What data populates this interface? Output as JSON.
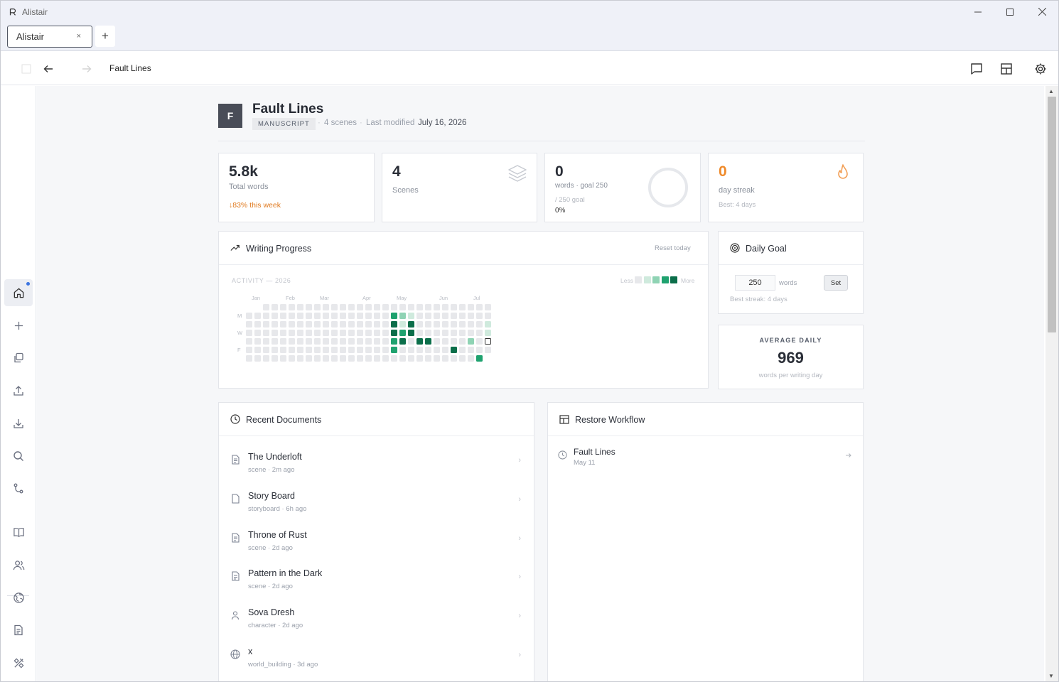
{
  "window": {
    "app_title": "Alistair"
  },
  "tabs": [
    {
      "label": "Alistair",
      "close": "×"
    }
  ],
  "new_tab": "+",
  "breadcrumb": "Fault Lines",
  "project": {
    "initial": "F",
    "title": "Fault Lines",
    "badge": "MANUSCRIPT",
    "scene_count": "4 scenes",
    "last_modified_label": "Last modified",
    "last_modified_date": "July 16, 2026"
  },
  "stats": {
    "words": {
      "value": "5.8k",
      "label": "Total words",
      "trend": "↓83% this week"
    },
    "scenes": {
      "value": "4",
      "label": "Scenes"
    },
    "today": {
      "value": "0",
      "label": "words · goal 250",
      "goal_note": "/ 250 goal",
      "percent": "0%",
      "progress": 0
    },
    "streak": {
      "value": "0",
      "label": "day streak",
      "best": "Best: 4 days"
    }
  },
  "writing_progress": {
    "title": "Writing Progress",
    "reset": "Reset today",
    "activity_label": "ACTIVITY — 2026",
    "legend_less": "Less",
    "legend_more": "More",
    "months": [
      "Jan",
      "Feb",
      "Mar",
      "Apr",
      "May",
      "Jun",
      "Jul"
    ],
    "days": [
      "M",
      "W",
      "F"
    ],
    "num_weeks": 29,
    "active_cells": [
      {
        "w": 17,
        "d": 1,
        "l": 3
      },
      {
        "w": 18,
        "d": 1,
        "l": 2
      },
      {
        "w": 19,
        "d": 1,
        "l": 1
      },
      {
        "w": 17,
        "d": 2,
        "l": 4
      },
      {
        "w": 18,
        "d": 2,
        "l": 1
      },
      {
        "w": 19,
        "d": 2,
        "l": 4
      },
      {
        "w": 17,
        "d": 3,
        "l": 4
      },
      {
        "w": 18,
        "d": 3,
        "l": 3
      },
      {
        "w": 19,
        "d": 3,
        "l": 4
      },
      {
        "w": 17,
        "d": 4,
        "l": 3
      },
      {
        "w": 18,
        "d": 4,
        "l": 4
      },
      {
        "w": 20,
        "d": 4,
        "l": 4
      },
      {
        "w": 21,
        "d": 4,
        "l": 4
      },
      {
        "w": 17,
        "d": 5,
        "l": 3
      },
      {
        "w": 24,
        "d": 5,
        "l": 4
      },
      {
        "w": 26,
        "d": 4,
        "l": 2
      },
      {
        "w": 28,
        "d": 2,
        "l": 1
      },
      {
        "w": 28,
        "d": 3,
        "l": 1
      },
      {
        "w": 27,
        "d": 6,
        "l": 3
      }
    ],
    "today_cell": {
      "w": 28,
      "d": 4
    },
    "colors": [
      "#e7e8eb",
      "#cfeadd",
      "#8fd3b4",
      "#1fa26f",
      "#0b6e4a"
    ]
  },
  "daily_goal": {
    "title": "Daily Goal",
    "value": "250",
    "unit": "words",
    "set": "Set",
    "best": "Best streak: 4 days"
  },
  "average_daily": {
    "label": "AVERAGE DAILY",
    "value": "969",
    "sub": "words per writing day"
  },
  "recent_documents": {
    "title": "Recent Documents",
    "items": [
      {
        "name": "The Underloft",
        "sub": "scene · 2m ago",
        "icon": "doc-icon"
      },
      {
        "name": "Story Board",
        "sub": "storyboard · 6h ago",
        "icon": "page-icon"
      },
      {
        "name": "Throne of Rust",
        "sub": "scene · 2d ago",
        "icon": "doc-icon"
      },
      {
        "name": "Pattern in the Dark",
        "sub": "scene · 2d ago",
        "icon": "doc-icon"
      },
      {
        "name": "Sova Dresh",
        "sub": "character · 2d ago",
        "icon": "person-icon"
      },
      {
        "name": "x",
        "sub": "world_building · 3d ago",
        "icon": "globe-icon"
      }
    ]
  },
  "restore_workflow": {
    "title": "Restore Workflow",
    "items": [
      {
        "name": "Fault Lines",
        "date": "May 11"
      }
    ]
  }
}
